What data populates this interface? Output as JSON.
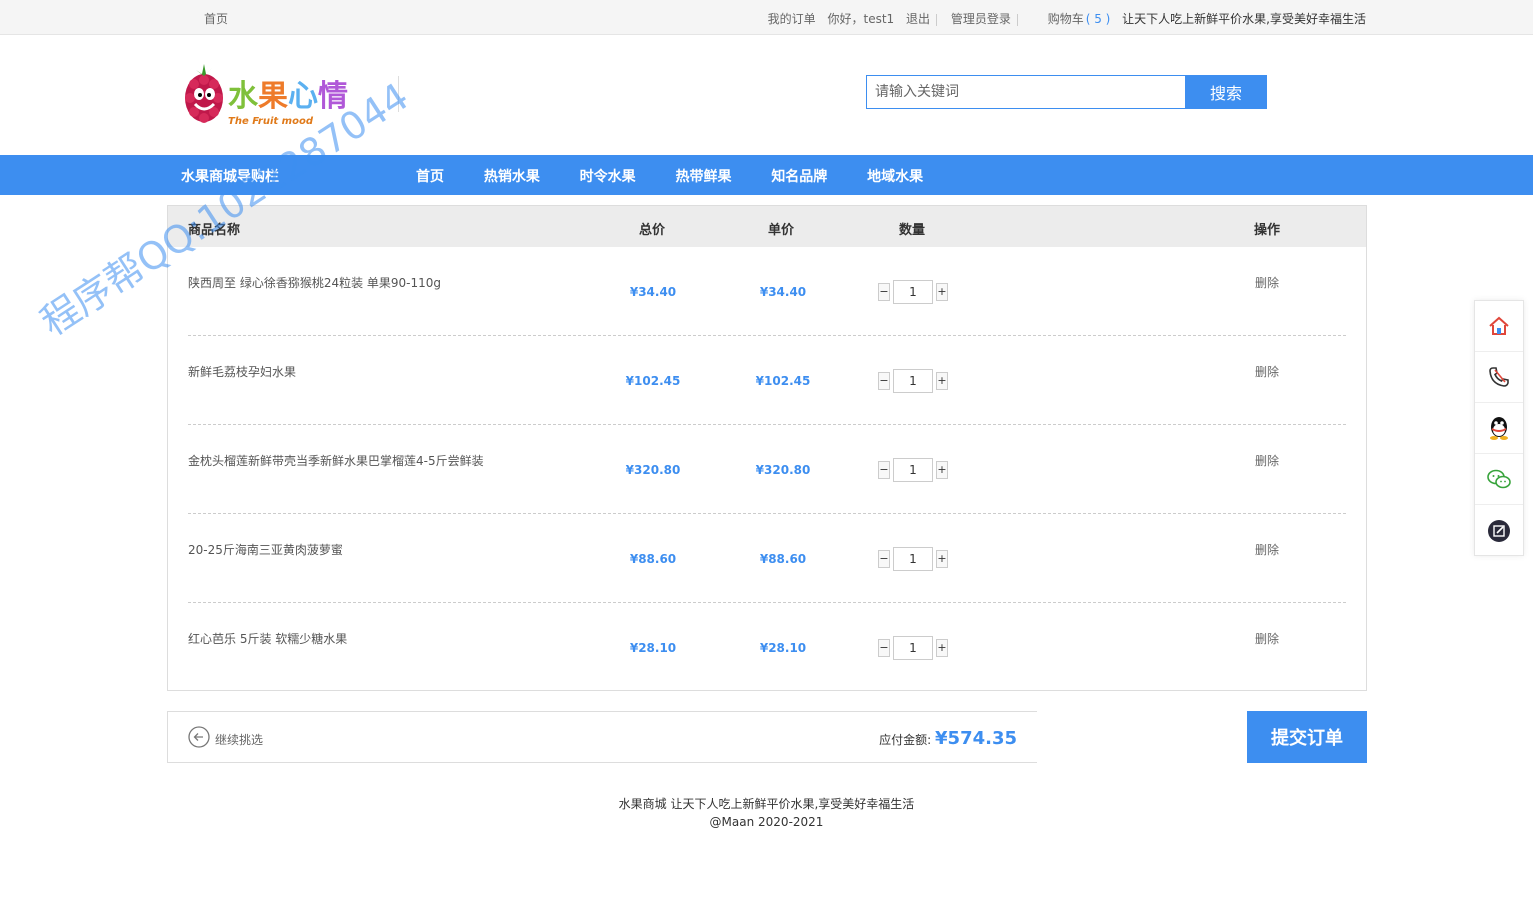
{
  "topbar": {
    "home": "首页",
    "my_orders": "我的订单",
    "greeting": "你好，test1",
    "logout": "退出",
    "admin_login": "管理员登录",
    "cart_label": "购物车",
    "cart_count": "( 5 )",
    "slogan": "让天下人吃上新鲜平价水果,享受美好幸福生活"
  },
  "logo": {
    "cn": "水果心情",
    "en": "The Fruit mood"
  },
  "search": {
    "placeholder": "请输入关键词",
    "button": "搜索"
  },
  "nav": {
    "title": "水果商城导购栏",
    "items": [
      "首页",
      "热销水果",
      "时令水果",
      "热带鲜果",
      "知名品牌",
      "地域水果"
    ]
  },
  "cart": {
    "headers": {
      "name": "商品名称",
      "total": "总价",
      "unit": "单价",
      "qty": "数量",
      "action": "操作"
    },
    "rows": [
      {
        "name": "陕西周至 绿心徐香猕猴桃24粒装 单果90-110g",
        "total": "¥34.40",
        "unit": "¥34.40",
        "qty": "1",
        "action": "删除"
      },
      {
        "name": "新鲜毛荔枝孕妇水果",
        "total": "¥102.45",
        "unit": "¥102.45",
        "qty": "1",
        "action": "删除"
      },
      {
        "name": "金枕头榴莲新鲜带壳当季新鲜水果巴掌榴莲4-5斤尝鲜装",
        "total": "¥320.80",
        "unit": "¥320.80",
        "qty": "1",
        "action": "删除"
      },
      {
        "name": "20-25斤海南三亚黄肉菠萝蜜",
        "total": "¥88.60",
        "unit": "¥88.60",
        "qty": "1",
        "action": "删除"
      },
      {
        "name": "红心芭乐 5斤装 软糯少糖水果",
        "total": "¥28.10",
        "unit": "¥28.10",
        "qty": "1",
        "action": "删除"
      }
    ],
    "minus": "−",
    "plus": "+"
  },
  "summary": {
    "continue": "继续挑选",
    "payable_label": "应付金额:",
    "payable_amount": "¥574.35",
    "submit": "提交订单"
  },
  "footer": {
    "line1": "水果商城 让天下人吃上新鲜平价水果,享受美好幸福生活",
    "line2": "@Maan 2020-2021"
  },
  "sidebar_icons": [
    "home-icon",
    "phone-icon",
    "qq-icon",
    "wechat-icon",
    "edit-icon"
  ],
  "watermark": "程序帮QQ:1022287044",
  "colors": {
    "accent": "#3d8ef0"
  }
}
